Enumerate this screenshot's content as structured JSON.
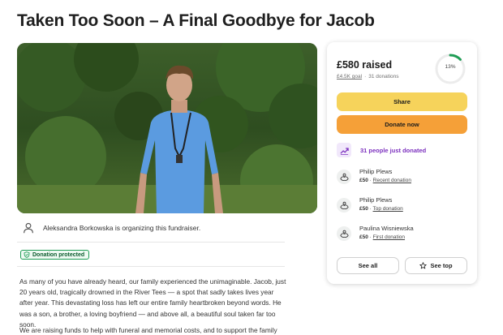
{
  "page": {
    "title": "Taken Too Soon – A Final Goodbye for Jacob"
  },
  "organizer": {
    "text": "Aleksandra Borkowska is organizing this fundraiser."
  },
  "badge": {
    "label": "Donation protected"
  },
  "story": {
    "paragraph1": "As many of you have already heard, our family experienced the unimaginable. Jacob, just 20 years old, tragically drowned in the River Tees — a spot that sadly takes lives year after year. This devastating loss has left our entire family heartbroken beyond words. He was a son, a brother, a loving boyfriend — and above all, a beautiful soul taken far too soon.",
    "paragraph2": "We are raising funds to help with funeral and memorial costs, and to support the family"
  },
  "donation_card": {
    "raised": "£580 raised",
    "goal": "£4.5K goal",
    "donations": "31 donations",
    "progress_percent": 13,
    "progress_label": "13%",
    "share_label": "Share",
    "donate_label": "Donate now",
    "recent_activity": "31 people just donated",
    "donors": [
      {
        "name": "Philip Plews",
        "amount": "£50",
        "kind": "Recent donation"
      },
      {
        "name": "Philip Plews",
        "amount": "£50",
        "kind": "Top donation"
      },
      {
        "name": "Paulina Wisniewska",
        "amount": "£50",
        "kind": "First donation"
      }
    ],
    "see_all_label": "See all",
    "see_top_label": "See top"
  },
  "colors": {
    "share_button": "#f6d35b",
    "donate_button": "#f5a038",
    "progress_ring": "#1f9d55",
    "activity_text": "#7b2fbe",
    "badge_border": "#1f9d55"
  }
}
